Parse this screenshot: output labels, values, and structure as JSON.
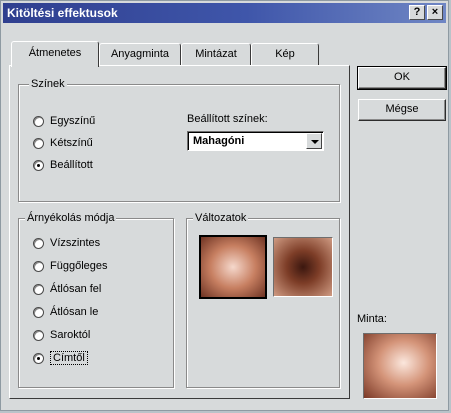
{
  "window": {
    "title": "Kitöltési effektusok",
    "help_label": "?",
    "close_label": "×"
  },
  "tabs": [
    {
      "label": "Átmenetes",
      "active": true
    },
    {
      "label": "Anyagminta",
      "active": false
    },
    {
      "label": "Mintázat",
      "active": false
    },
    {
      "label": "Kép",
      "active": false
    }
  ],
  "colors_group": {
    "legend": "Színek",
    "options": [
      {
        "label": "Egyszínű",
        "selected": false
      },
      {
        "label": "Kétszínű",
        "selected": false
      },
      {
        "label": "Beállított",
        "selected": true
      }
    ],
    "preset_label": "Beállított színek:",
    "preset_value": "Mahagóni"
  },
  "shading_group": {
    "legend": "Árnyékolás módja",
    "options": [
      {
        "label": "Vízszintes",
        "selected": false
      },
      {
        "label": "Függőleges",
        "selected": false
      },
      {
        "label": "Átlósan fel",
        "selected": false
      },
      {
        "label": "Átlósan le",
        "selected": false
      },
      {
        "label": "Saroktól",
        "selected": false
      },
      {
        "label": "Címtől",
        "selected": true
      }
    ]
  },
  "variants_group": {
    "legend": "Változatok"
  },
  "buttons": {
    "ok": "OK",
    "cancel": "Mégse"
  },
  "sample_label": "Minta:",
  "preset_color": "#9a4e34"
}
